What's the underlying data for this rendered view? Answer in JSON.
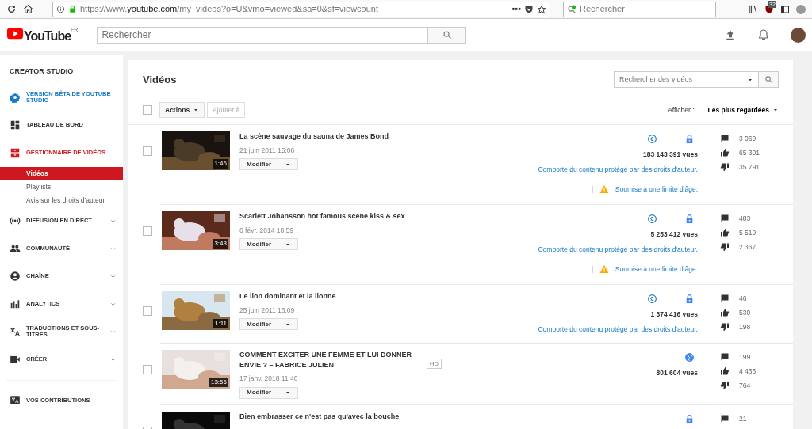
{
  "browser": {
    "url_scheme": "https://www.",
    "url_domain": "youtube.com",
    "url_path": "/my_videos?o=U&vmo=viewed&sa=0&sf=viewcount",
    "more": "•••",
    "search_placeholder": "Rechercher",
    "badge": "32"
  },
  "header": {
    "logo": "YouTube",
    "region": "FR",
    "search_placeholder": "Rechercher"
  },
  "sidebar": {
    "title": "CREATOR STUDIO",
    "items": [
      {
        "label": "VERSION BÊTA DE YOUTUBE STUDIO",
        "kind": "beta",
        "selected": false,
        "expandable": false
      },
      {
        "label": "TABLEAU DE BORD",
        "kind": "section",
        "selected": false,
        "expandable": false
      },
      {
        "label": "GESTIONNAIRE DE VIDÉOS",
        "kind": "section",
        "selected": true,
        "expandable": false
      },
      {
        "label": "Vidéos",
        "kind": "sub",
        "selected": true
      },
      {
        "label": "Playlists",
        "kind": "sub",
        "selected": false
      },
      {
        "label": "Avis sur les droits d'auteur",
        "kind": "sub",
        "selected": false
      },
      {
        "label": "DIFFUSION EN DIRECT",
        "kind": "section",
        "selected": false,
        "expandable": true
      },
      {
        "label": "COMMUNAUTÉ",
        "kind": "section",
        "selected": false,
        "expandable": true
      },
      {
        "label": "CHAÎNE",
        "kind": "section",
        "selected": false,
        "expandable": true
      },
      {
        "label": "ANALYTICS",
        "kind": "section",
        "selected": false,
        "expandable": true
      },
      {
        "label": "TRADUCTIONS ET SOUS-TITRES",
        "kind": "section",
        "selected": false,
        "expandable": true
      },
      {
        "label": "CRÉER",
        "kind": "section",
        "selected": false,
        "expandable": true
      },
      {
        "kind": "divider"
      },
      {
        "label": "VOS CONTRIBUTIONS",
        "kind": "section",
        "selected": false,
        "expandable": false
      }
    ]
  },
  "main": {
    "title": "Vidéos",
    "search_placeholder": "Rechercher des vidéos",
    "select_all_checked": false,
    "actions": "Actions",
    "add_to": "Ajouter à",
    "filter_label": "Afficher :",
    "filter_value": "Les plus regardées",
    "videos": [
      {
        "checked": false,
        "title": "La scène sauvage du sauna de James Bond",
        "date": "21 juin 2011 15:06",
        "duration": "1:46",
        "edit": "Modifier",
        "copyright": true,
        "public": false,
        "views": "183 143 391 vues",
        "claim": "Comporte du contenu protégé par des droits d'auteur.",
        "age_separator": "|",
        "age": "Soumise à une limite d'âge.",
        "comments": "3 069",
        "likes": "65 301",
        "dislikes": "35 791"
      },
      {
        "checked": false,
        "title": "Scarlett Johansson hot famous scene kiss & sex",
        "date": "6 févr. 2014 18:59",
        "duration": "3:43",
        "edit": "Modifier",
        "copyright": true,
        "public": false,
        "views": "5 253 412 vues",
        "claim": "Comporte du contenu protégé par des droits d'auteur.",
        "age_separator": "|",
        "age": "Soumise à une limite d'âge.",
        "comments": "483",
        "likes": "5 519",
        "dislikes": "2 367"
      },
      {
        "checked": false,
        "title": "Le lion dominant et la lionne",
        "date": "25 juin 2011 16:09",
        "duration": "1:11",
        "edit": "Modifier",
        "copyright": true,
        "public": false,
        "views": "1 374 416 vues",
        "claim": "Comporte du contenu protégé par des droits d'auteur.",
        "comments": "46",
        "likes": "530",
        "dislikes": "198"
      },
      {
        "checked": false,
        "title": "COMMENT EXCITER UNE FEMME ET LUI DONNER ENVIE ? – FABRICE JULIEN",
        "hd": "HD",
        "date": "17 janv. 2018 11:40",
        "duration": "13:56",
        "edit": "Modifier",
        "copyright": false,
        "public": true,
        "views": "801 604 vues",
        "comments": "199",
        "likes": "4 436",
        "dislikes": "764"
      },
      {
        "title": "Bien embrasser ce n'est pas qu'avec la bouche",
        "copyright": false,
        "public": false,
        "comments": "21"
      }
    ]
  }
}
